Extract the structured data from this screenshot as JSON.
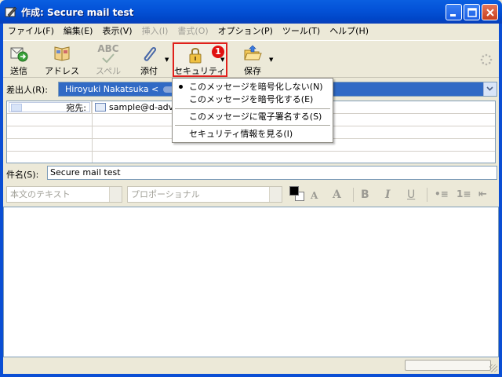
{
  "window": {
    "title": "作成: Secure mail test"
  },
  "menu": [
    {
      "label": "ファイル(F)",
      "enabled": true
    },
    {
      "label": "編集(E)",
      "enabled": true
    },
    {
      "label": "表示(V)",
      "enabled": true
    },
    {
      "label": "挿入(I)",
      "enabled": false
    },
    {
      "label": "書式(O)",
      "enabled": false
    },
    {
      "label": "オプション(P)",
      "enabled": true
    },
    {
      "label": "ツール(T)",
      "enabled": true
    },
    {
      "label": "ヘルプ(H)",
      "enabled": true
    }
  ],
  "toolbar": {
    "send": "送信",
    "address": "アドレス",
    "spell_icon": "ABC",
    "spell": "スペル",
    "attach": "添付",
    "security": "セキュリティ",
    "save": "保存",
    "callout": "1"
  },
  "sender": {
    "label": "差出人(R):",
    "value": "Hiroyuki Nakatsuka <"
  },
  "recipients": [
    {
      "type": "宛先:",
      "address": "sample@d-adv"
    }
  ],
  "subject": {
    "label": "件名(S):",
    "value": "Secure mail test"
  },
  "format": {
    "paragraph": "本文のテキスト",
    "font": "プロポーショナル",
    "btn_smaller": "A",
    "btn_larger": "A",
    "btn_bold": "B",
    "btn_italic": "I",
    "btn_underline": "U",
    "btn_bullets": "•≡",
    "btn_numbers": "1≡",
    "btn_outdent": "⇤"
  },
  "security_menu": {
    "items": [
      {
        "label": "このメッセージを暗号化しない(N)",
        "checked": true
      },
      {
        "label": "このメッセージを暗号化する(E)",
        "checked": false
      },
      {
        "label": "このメッセージに電子署名する(S)",
        "checked": false
      },
      {
        "label": "セキュリティ情報を見る(I)",
        "checked": false
      }
    ]
  },
  "colors": {
    "titlebar": "#0453d8",
    "highlight": "#e0201c",
    "selection": "#316ac5"
  }
}
